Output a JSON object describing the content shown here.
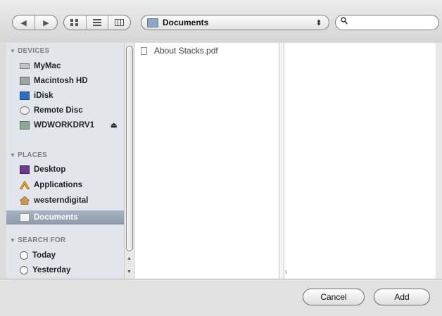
{
  "toolbar": {
    "back_glyph": "◀",
    "forward_glyph": "▶",
    "view_icons": [
      "icon-view-icon",
      "list-view-icon",
      "column-view-icon"
    ],
    "location": "Documents",
    "location_arrows": "⬍",
    "search_glyph": "🔍",
    "search_value": ""
  },
  "sidebar": {
    "devices_header": "DEVICES",
    "places_header": "PLACES",
    "search_header": "SEARCH FOR",
    "devices": [
      {
        "label": "MyMac"
      },
      {
        "label": "Macintosh HD"
      },
      {
        "label": "iDisk"
      },
      {
        "label": "Remote Disc"
      },
      {
        "label": "WDWORKDRV1"
      }
    ],
    "eject_glyph": "⏏",
    "places": [
      {
        "label": "Desktop"
      },
      {
        "label": "Applications"
      },
      {
        "label": "westerndigital"
      },
      {
        "label": "Documents"
      }
    ],
    "search": [
      {
        "label": "Today"
      },
      {
        "label": "Yesterday"
      }
    ]
  },
  "browser": {
    "files": [
      {
        "name": "About Stacks.pdf"
      }
    ],
    "column_mark": "ı"
  },
  "buttons": {
    "cancel": "Cancel",
    "add": "Add"
  },
  "colors": {
    "selected_bg": "#8c9aab",
    "sidebar_bg": "#e2e6ec",
    "window_bg": "#dcdcdc"
  }
}
